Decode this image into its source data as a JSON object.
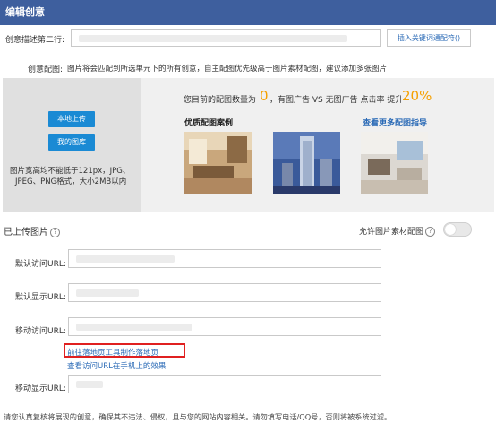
{
  "header": {
    "title": "编辑创意"
  },
  "desc2": {
    "label": "创意描述第二行:",
    "keyword_button": "插入关键词通配符()"
  },
  "images": {
    "label": "创意配图:",
    "note": "图片将会匹配到所选单元下的所有创意，自主配图优先级高于图片素材配图，建议添加多张图片",
    "upload_local": "本地上传",
    "my_gallery": "我的图库",
    "spec_line1": "图片宽高均不能低于121px，JPG、",
    "spec_line2": "JPEG、PNG格式，大小2MB以内",
    "stat_prefix": "您目前的配图数量为",
    "stat_count": "0",
    "stat_middle": "，有图广告 VS 无图广告 点击率 提升",
    "stat_percent": "20%",
    "examples_title": "优质配图案例",
    "more_guide": "查看更多配图指导",
    "example_icons": [
      "living-room-photo",
      "city-tower-photo",
      "interior-apartment-photo"
    ]
  },
  "uploaded": {
    "title": "已上传图片",
    "allow_material": "允许图片素材配图",
    "toggle_on": false
  },
  "fields": {
    "default_visit": "默认访问URL:",
    "default_display": "默认显示URL:",
    "mobile_visit": "移动访问URL:",
    "mobile_display": "移动显示URL:",
    "landing_tool_link": "前往落地页工具制作落地页",
    "phone_preview_link": "查看访问URL在手机上的效果"
  },
  "footer": {
    "notice": "请您认真复核将展现的创意，确保其不违法、侵权，且与您的网站内容相关。请勿填写电话/QQ号，否则将被系统过滤。"
  },
  "colors": {
    "header_bg": "#3e5f9e",
    "accent_blue": "#1a8ad4",
    "orange": "#f5a000",
    "link": "#2a6ab6",
    "highlight_red": "#e02020"
  }
}
